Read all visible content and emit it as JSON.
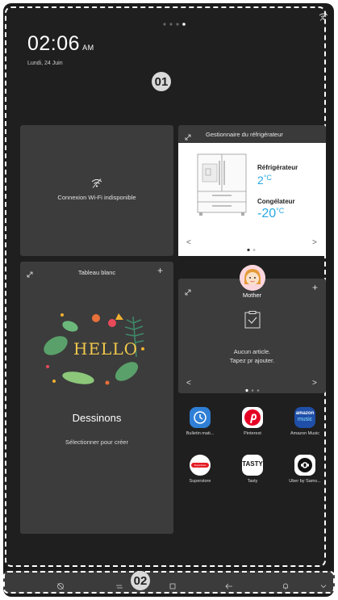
{
  "status": {
    "wifi_icon": "wifi-icon",
    "page_indicator_count": 4,
    "page_indicator_active": 3
  },
  "clock": {
    "time": "02:06",
    "ampm": "AM",
    "date": "Lundi, 24 Juin"
  },
  "annotations": {
    "region1": "01",
    "region2": "02"
  },
  "wifi_widget": {
    "message": "Connexion Wi-Fi indisponible"
  },
  "fridge_widget": {
    "title": "Gestionnaire du réfrigérateur",
    "fridge_label": "Réfrigérateur",
    "fridge_temp": "2",
    "fridge_unit": "°C",
    "freezer_label": "Congélateur",
    "freezer_temp": "-20",
    "freezer_unit": "°C",
    "prev": "<",
    "next": ">"
  },
  "whiteboard_widget": {
    "title": "Tableau blanc",
    "add": "+",
    "art_text": "HELLO",
    "heading": "Dessinons",
    "subtitle": "Sélectionner pour créer"
  },
  "list_widget": {
    "user": "Mother",
    "add": "+",
    "empty_line1": "Aucun article.",
    "empty_line2": "Tapez pr ajouter.",
    "prev": "<",
    "next": ">"
  },
  "apps": [
    {
      "label": "Bulletin mati...",
      "icon": "bulletin-icon",
      "color": "#2f7fd6"
    },
    {
      "label": "Pinterest",
      "icon": "pinterest-icon",
      "color": "#e60023"
    },
    {
      "label": "Amazon Music",
      "icon": "amazon-music-icon",
      "color": "#1f4fa8"
    },
    {
      "label": "Superstore",
      "icon": "superstore-icon",
      "color": "#ffffff"
    },
    {
      "label": "Tasty",
      "icon": "tasty-icon",
      "color": "#ffffff"
    },
    {
      "label": "Uber by Sams...",
      "icon": "uber-icon",
      "color": "#ffffff"
    }
  ],
  "amazon_text": {
    "line1": "amazon",
    "line2": "music"
  },
  "tasty_text": "TASTY",
  "superstore_text": "Superstore",
  "nav": [
    "mute-icon",
    "recent-apps-icon",
    "home-icon",
    "back-icon",
    "notification-icon",
    "chevron-down-icon"
  ]
}
